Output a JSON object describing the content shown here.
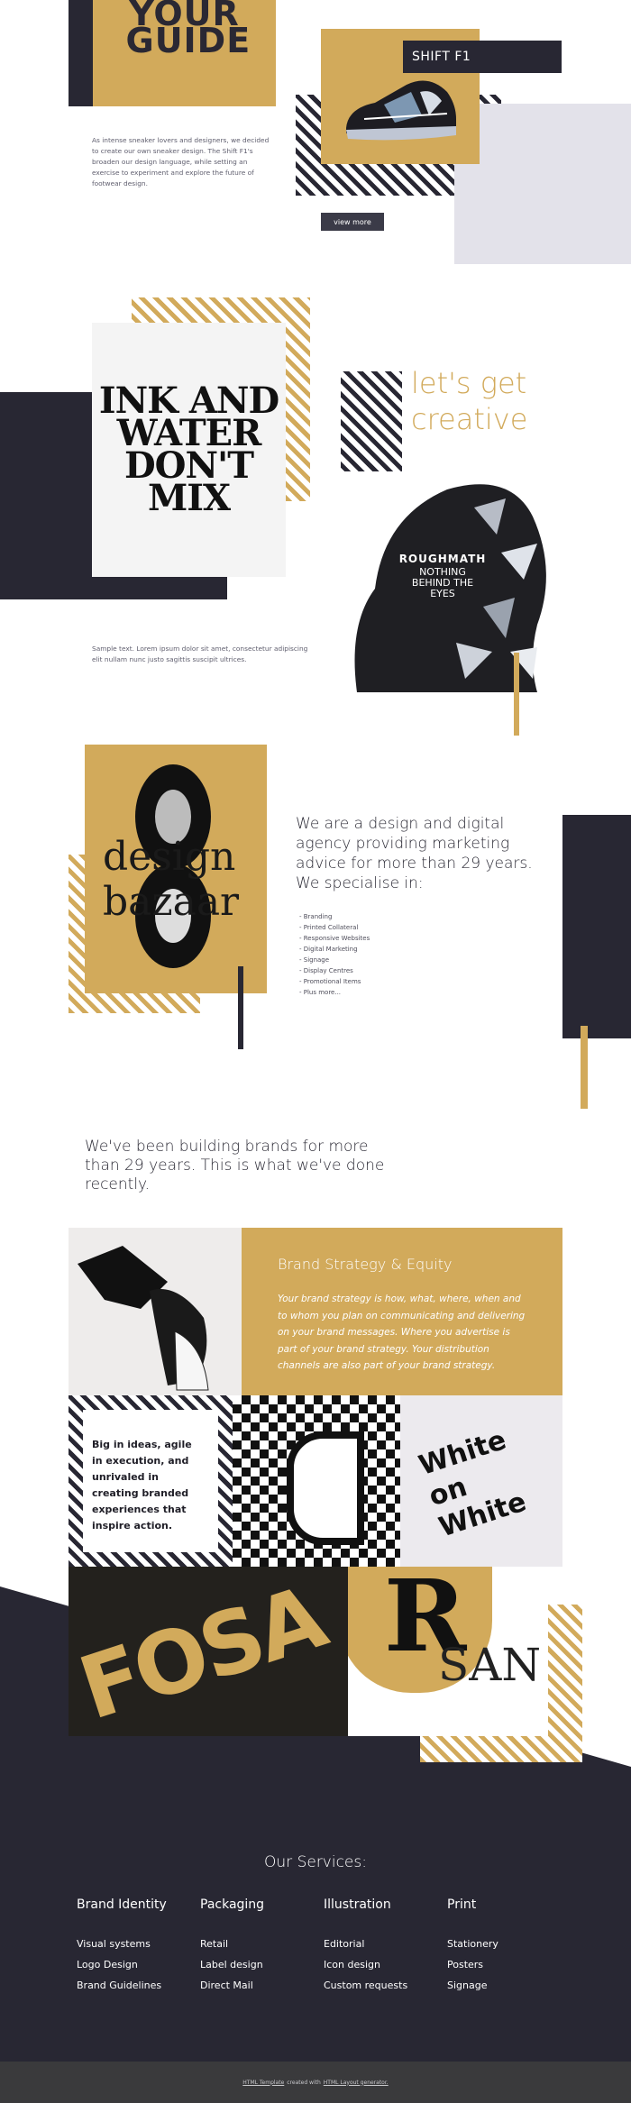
{
  "hero": {
    "logo_text": "YOUR GUIDE",
    "shoe_label": "SHIFT F1",
    "intro": "As intense sneaker lovers and designers, we decided to create our own sneaker design. The Shift F1's broaden our design language, while setting an exercise to experiment and explore the future of footwear design.",
    "button": "view more"
  },
  "poster": {
    "ink_text": "INK AND WATER DON'T MIX",
    "headline": "let's get creative",
    "rough_title": "ROUGHMATH",
    "rough_sub": "NOTHING BEHIND THE EYES",
    "sample": "Sample text. Lorem ipsum dolor sit amet, consectetur adipiscing elit nullam nunc justo sagittis suscipit ultrices."
  },
  "agency": {
    "poster_text": "design bazaar",
    "headline": "We are a design and digital agency providing marketing advice for more than 29 years. We specialise in:",
    "list": [
      "- Branding",
      "- Printed Collateral",
      "- Responsive Websites",
      "- Digital Marketing",
      "- Signage",
      "- Display Centres",
      "- Promotional Items",
      "- Plus more..."
    ]
  },
  "brands": {
    "headline": "We've been building brands for more than 29 years. This is what we've done recently."
  },
  "portfolio": {
    "strategy_title": "Brand Strategy & Equity",
    "strategy_text": "Your brand strategy is how, what, where, when and to whom you plan on communicating and delivering on your brand messages. Where you advertise is part of your brand strategy. Your distribution channels are also part of your brand strategy.",
    "agile_text": "Big in ideas, agile in execution, and unrivaled in creating branded experiences that inspire action.",
    "white_text": "White on White",
    "fosa_text": "FOSA"
  },
  "services": {
    "title": "Our Services:",
    "columns": [
      {
        "heading": "Brand Identity",
        "items": [
          "Visual systems",
          "Logo Design",
          "Brand Guidelines"
        ]
      },
      {
        "heading": "Packaging",
        "items": [
          "Retail",
          "Label design",
          "Direct Mail"
        ]
      },
      {
        "heading": "Illustration",
        "items": [
          "Editorial",
          "Icon design",
          "Custom requests"
        ]
      },
      {
        "heading": "Print",
        "items": [
          "Stationery",
          "Posters",
          "Signage"
        ]
      }
    ]
  },
  "footer": {
    "link1": "HTML Template",
    "middle": "created with",
    "link2": "HTML Layout generator."
  },
  "colors": {
    "dark": "#282733",
    "gold": "#d2aa5b",
    "light_gray": "#e3e2ea"
  }
}
